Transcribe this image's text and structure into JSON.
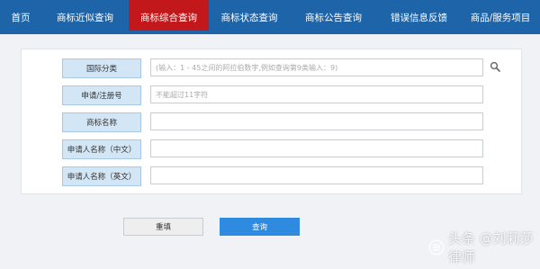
{
  "nav": {
    "items": [
      {
        "label": "首页"
      },
      {
        "label": "商标近似查询"
      },
      {
        "label": "商标综合查询"
      },
      {
        "label": "商标状态查询"
      },
      {
        "label": "商标公告查询"
      },
      {
        "label": "错误信息反馈"
      },
      {
        "label": "商品/服务项目"
      }
    ],
    "active_index": 2
  },
  "form": {
    "fields": [
      {
        "label": "国际分类",
        "placeholder": "(输入：1 - 45之间的阿拉伯数字,例如查询第9类输入：9)",
        "value": ""
      },
      {
        "label": "申请/注册号",
        "placeholder": "不能超过11字符",
        "value": ""
      },
      {
        "label": "商标名称",
        "placeholder": "",
        "value": ""
      },
      {
        "label": "申请人名称（中文）",
        "placeholder": "",
        "value": ""
      },
      {
        "label": "申请人名称（英文）",
        "placeholder": "",
        "value": ""
      }
    ]
  },
  "buttons": {
    "reset_label": "重填",
    "query_label": "查询"
  },
  "watermark": {
    "text": "头条 @刘莉莎律师"
  },
  "colors": {
    "nav_bg": "#1e64a8",
    "nav_active": "#c2181b",
    "label_bg": "#d3e6f5",
    "query_button": "#2f8be0"
  }
}
